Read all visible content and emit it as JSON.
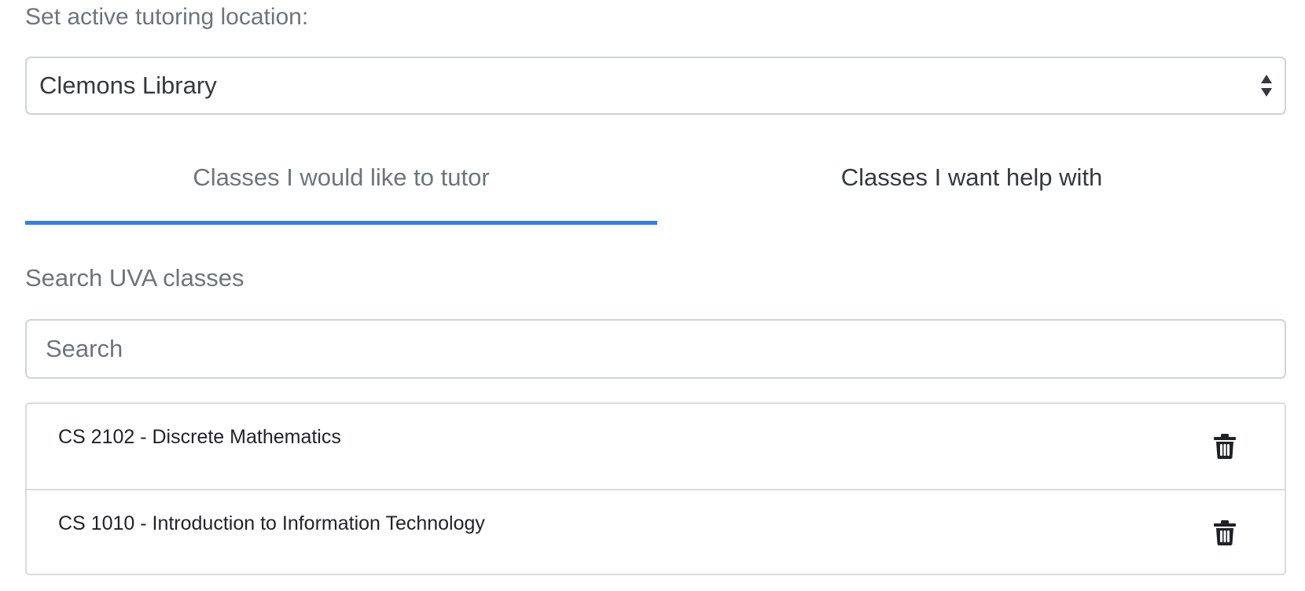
{
  "location": {
    "label": "Set active tutoring location:",
    "selected": "Clemons Library"
  },
  "tabs": [
    {
      "label": "Classes I would like to tutor",
      "active": true
    },
    {
      "label": "Classes I want help with",
      "active": false
    }
  ],
  "search": {
    "label": "Search UVA classes",
    "placeholder": "Search",
    "value": ""
  },
  "classes": [
    {
      "name": "CS 2102 - Discrete Mathematics",
      "action_icon": "trash-icon"
    },
    {
      "name": "CS 1010 - Introduction to Information Technology",
      "action_icon": "trash-icon"
    }
  ],
  "colors": {
    "accent": "#2f80ed",
    "muted_text": "#6c757d",
    "border": "#ced4da"
  }
}
